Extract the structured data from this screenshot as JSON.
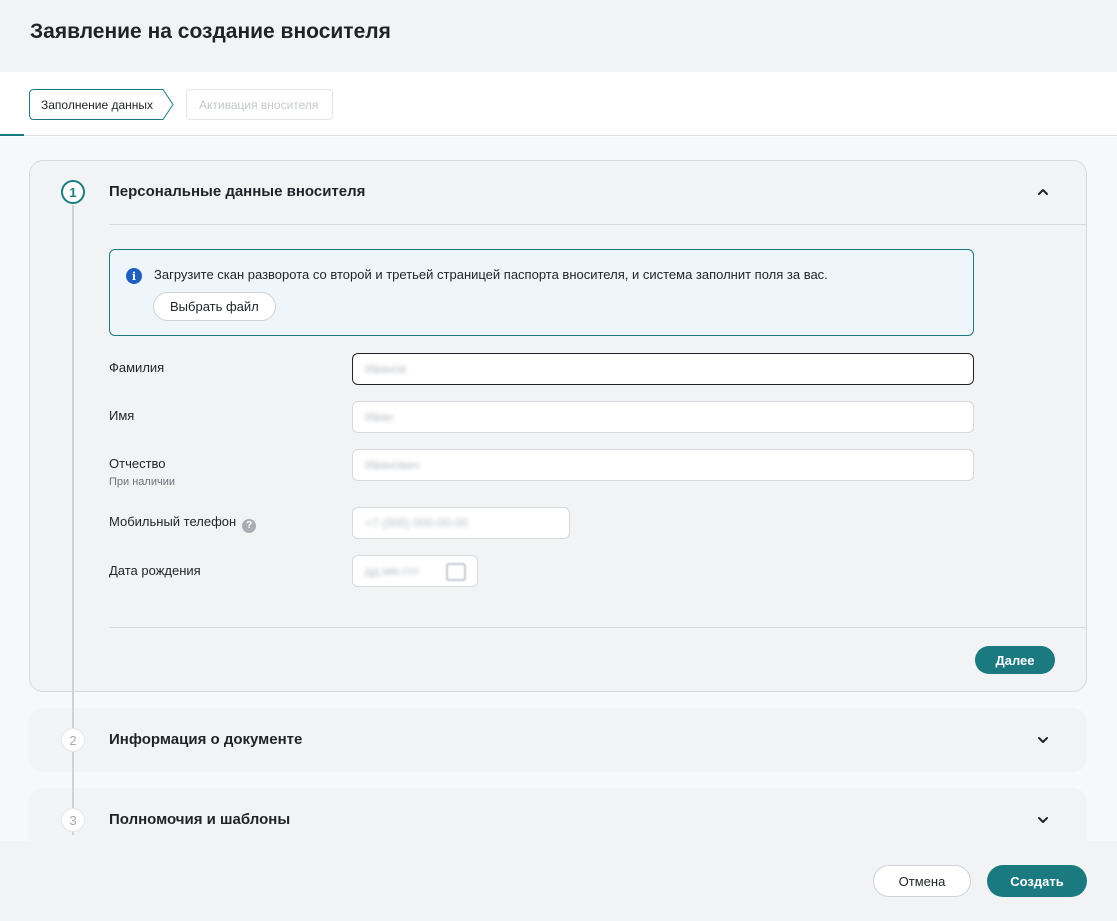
{
  "page": {
    "title": "Заявление на создание вносителя"
  },
  "steps": [
    {
      "label": "Заполнение данных",
      "state": "active"
    },
    {
      "label": "Активация вносителя",
      "state": "inactive"
    }
  ],
  "sections": [
    {
      "number": "1",
      "title": "Персональные данные вносителя",
      "expanded": true,
      "chevron": "chevron-up-icon"
    },
    {
      "number": "2",
      "title": "Информация о документе",
      "expanded": false,
      "chevron": "chevron-down-icon"
    },
    {
      "number": "3",
      "title": "Полномочия и шаблоны",
      "expanded": false,
      "chevron": "chevron-down-icon"
    }
  ],
  "info": {
    "icon": "info-icon",
    "text": "Загрузите скан разворота со второй и третьей страницей паспорта вносителя, и система заполнит поля за вас.",
    "button": "Выбрать файл"
  },
  "fields": {
    "lastname": {
      "label": "Фамилия",
      "placeholder": "Иванов"
    },
    "firstname": {
      "label": "Имя",
      "placeholder": "Иван"
    },
    "middlename": {
      "label": "Отчество",
      "hint": "При наличии",
      "placeholder": "Иванович"
    },
    "phone": {
      "label": "Мобильный телефон",
      "placeholder": "+7 (000) 000-00-00",
      "help_icon": "question-icon"
    },
    "birthdate": {
      "label": "Дата рождения",
      "placeholder": "дд.мм.гггг",
      "icon": "calendar-icon"
    }
  },
  "buttons": {
    "next": "Далее",
    "cancel": "Отмена",
    "create": "Создать"
  },
  "colors": {
    "accent": "#1a7a80",
    "info_icon": "#1f5fbf",
    "background": "#f2f3f5"
  }
}
